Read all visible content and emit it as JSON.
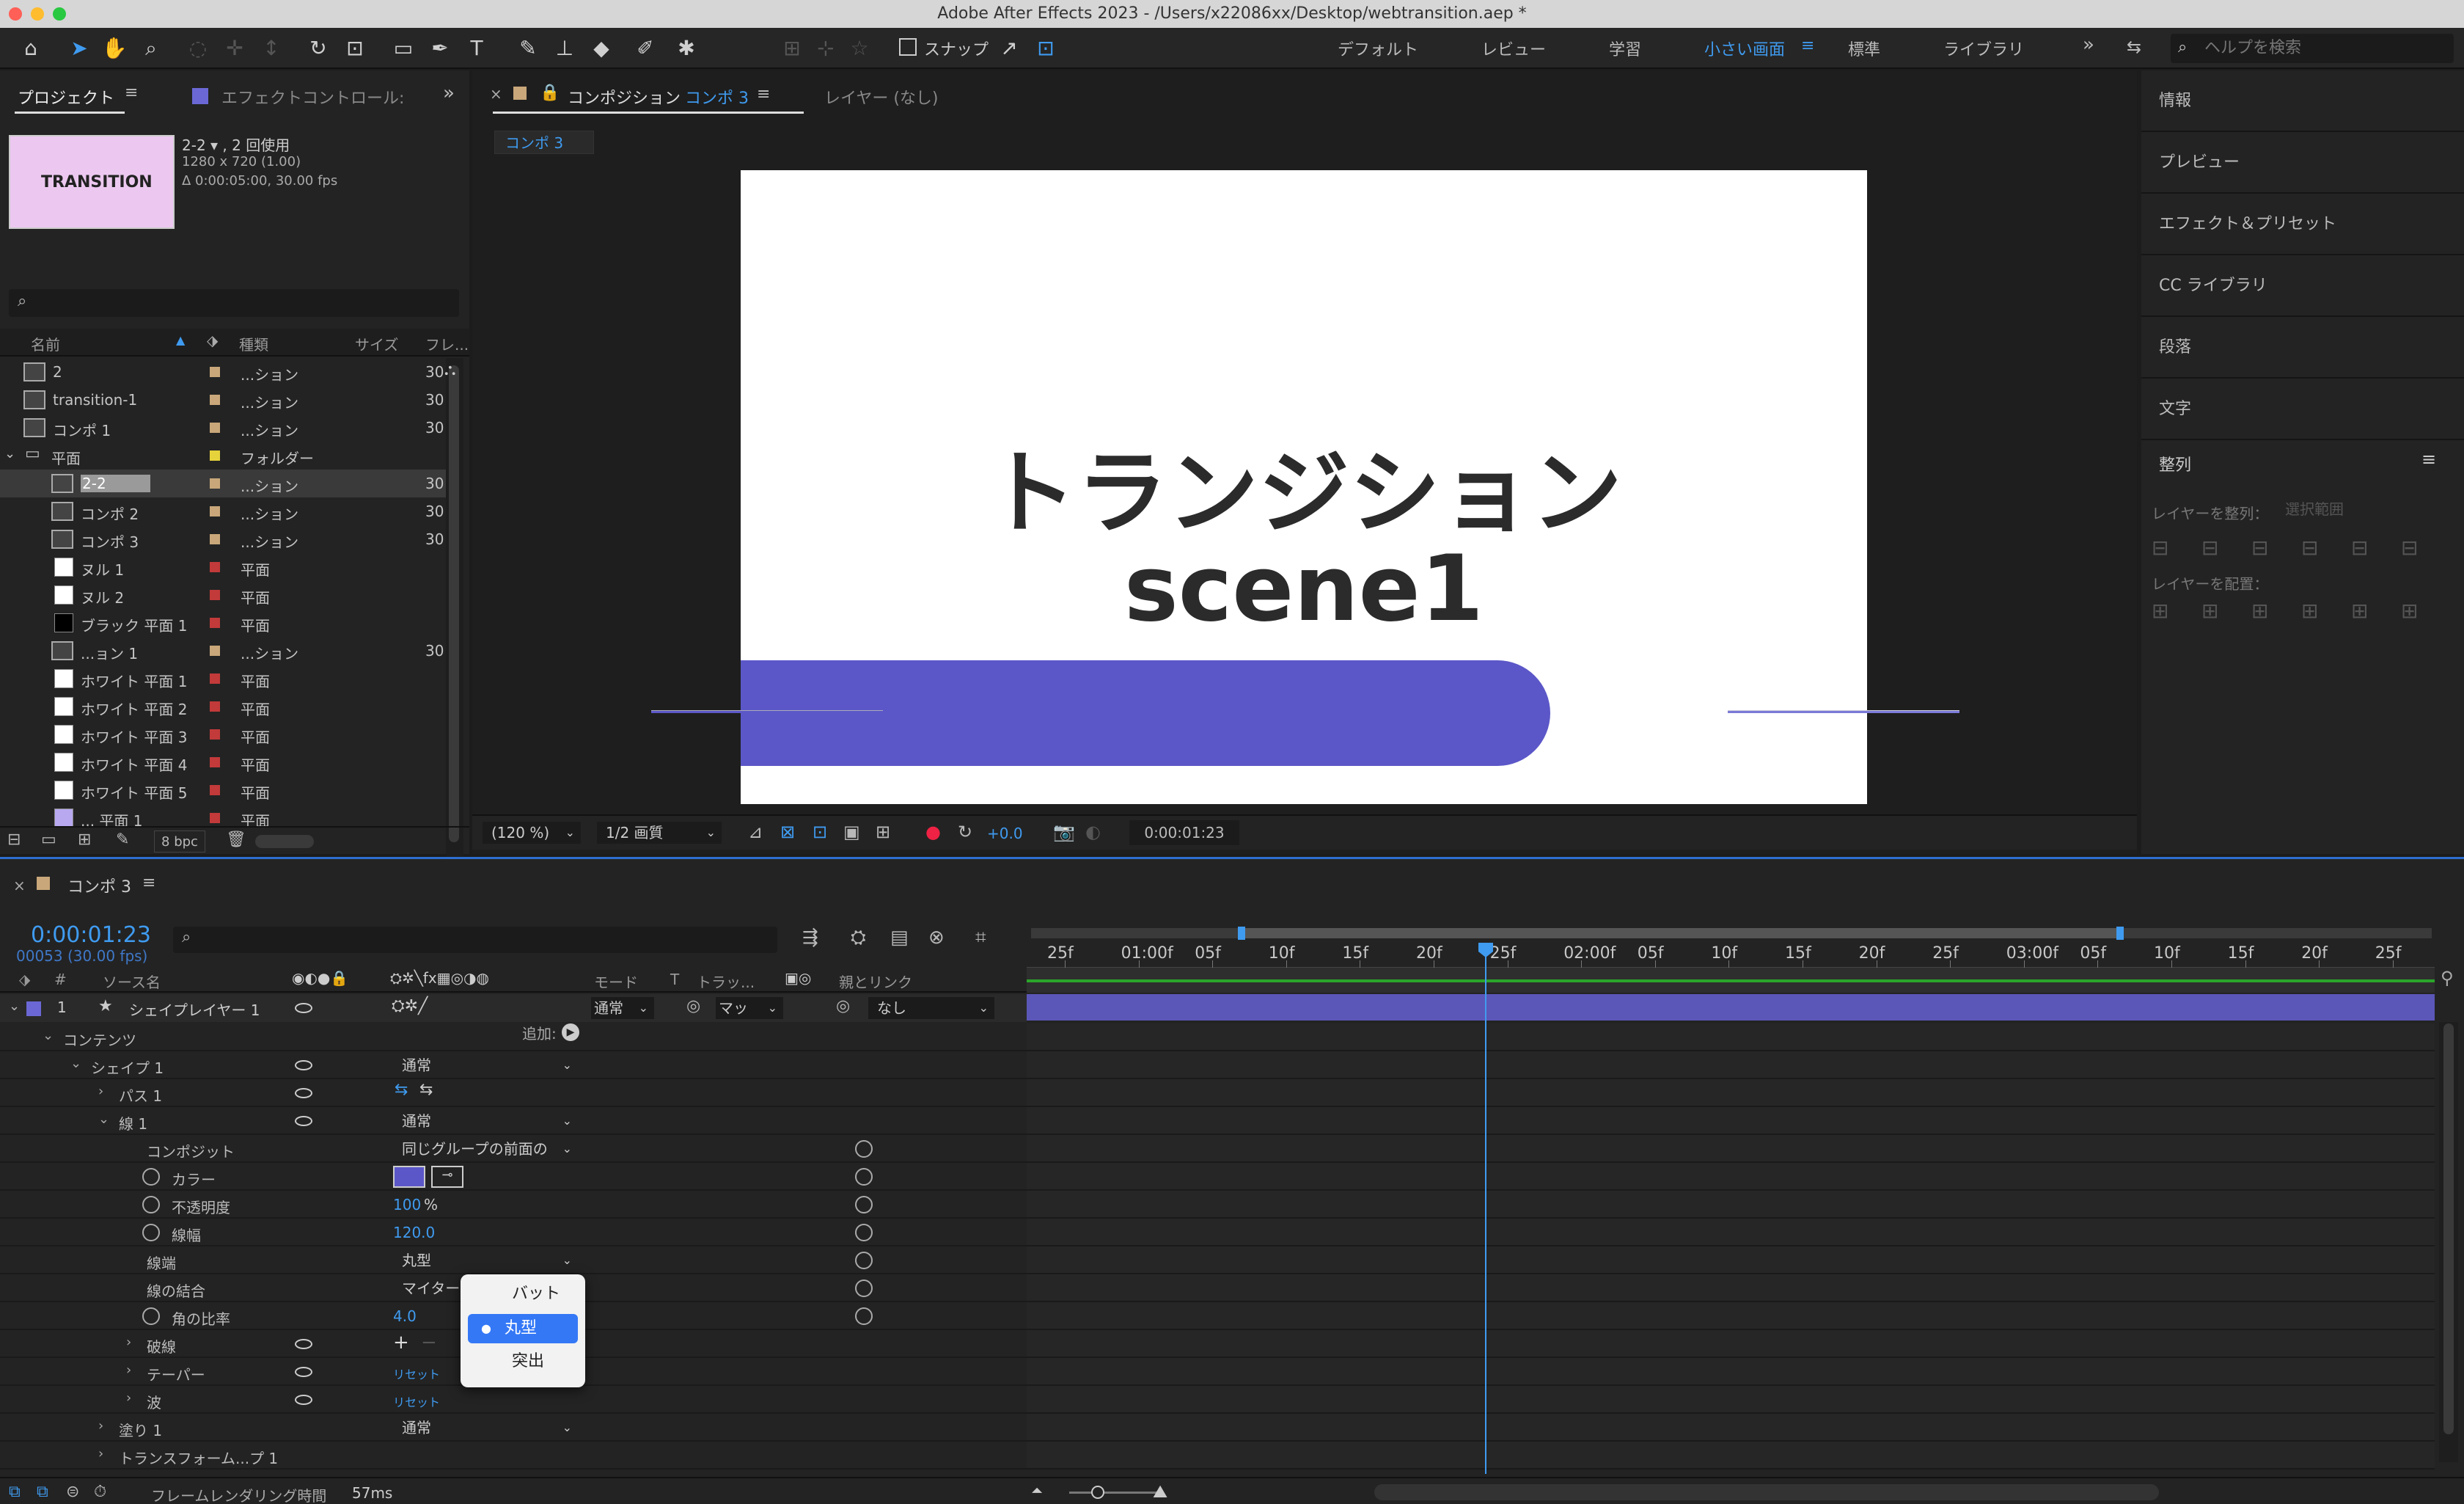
{
  "window": {
    "title": "Adobe After Effects 2023 - /Users/x22086xx/Desktop/webtransition.aep *"
  },
  "toolbar": {
    "snap_label": "スナップ",
    "workspaces": [
      "デフォルト",
      "レビュー",
      "学習",
      "小さい画面",
      "標準",
      "ライブラリ"
    ],
    "active_workspace": "小さい画面",
    "help_placeholder": "ヘルプを検索"
  },
  "project": {
    "tab_project": "プロジェクト",
    "tab_effects": "エフェクトコントロール:",
    "preview_label": "TRANSITION",
    "item_name": "2-2 ▾ , 2 回使用",
    "item_size": "1280 x 720 (1.00)",
    "item_duration": "Δ 0:00:05:00, 30.00 fps",
    "search_placeholder": "",
    "columns": [
      "名前",
      "種類",
      "サイズ",
      "フレ..."
    ],
    "bpc": "8 bpc",
    "items": [
      {
        "name": "2",
        "type": "...ション",
        "fps": "30",
        "color": "#c9a77a",
        "icon": "comp",
        "indent": 0
      },
      {
        "name": "transition-1",
        "type": "...ション",
        "fps": "30",
        "color": "#c9a77a",
        "icon": "comp",
        "indent": 0
      },
      {
        "name": "コンポ 1",
        "type": "...ション",
        "fps": "30",
        "color": "#c9a77a",
        "icon": "comp",
        "indent": 0
      },
      {
        "name": "平面",
        "type": "フォルダー",
        "fps": "",
        "color": "#e6d33b",
        "icon": "folder",
        "indent": 0
      },
      {
        "name": "2-2",
        "type": "...ション",
        "fps": "30",
        "color": "#c9a77a",
        "icon": "comp",
        "indent": 1,
        "selected": true
      },
      {
        "name": "コンポ 2",
        "type": "...ション",
        "fps": "30",
        "color": "#c9a77a",
        "icon": "comp",
        "indent": 1
      },
      {
        "name": "コンポ 3",
        "type": "...ション",
        "fps": "30",
        "color": "#c9a77a",
        "icon": "comp",
        "indent": 1
      },
      {
        "name": "ヌル 1",
        "type": "平面",
        "fps": "",
        "color": "#c23a3a",
        "icon": "white",
        "indent": 1
      },
      {
        "name": "ヌル 2",
        "type": "平面",
        "fps": "",
        "color": "#c23a3a",
        "icon": "white",
        "indent": 1
      },
      {
        "name": "ブラック 平面 1",
        "type": "平面",
        "fps": "",
        "color": "#c23a3a",
        "icon": "black",
        "indent": 1
      },
      {
        "name": "...ョン 1",
        "type": "...ション",
        "fps": "30",
        "color": "#c9a77a",
        "icon": "comp",
        "indent": 1
      },
      {
        "name": "ホワイト 平面 1",
        "type": "平面",
        "fps": "",
        "color": "#c23a3a",
        "icon": "white",
        "indent": 1
      },
      {
        "name": "ホワイト 平面 2",
        "type": "平面",
        "fps": "",
        "color": "#c23a3a",
        "icon": "white",
        "indent": 1
      },
      {
        "name": "ホワイト 平面 3",
        "type": "平面",
        "fps": "",
        "color": "#c23a3a",
        "icon": "white",
        "indent": 1
      },
      {
        "name": "ホワイト 平面 4",
        "type": "平面",
        "fps": "",
        "color": "#c23a3a",
        "icon": "white",
        "indent": 1
      },
      {
        "name": "ホワイト 平面 5",
        "type": "平面",
        "fps": "",
        "color": "#c23a3a",
        "icon": "white",
        "indent": 1
      },
      {
        "name": "... 平面 1",
        "type": "平面",
        "fps": "",
        "color": "#c23a3a",
        "icon": "lavender",
        "indent": 1
      }
    ]
  },
  "composition": {
    "tab_label": "コンポジション",
    "tab_comp": "コンポ 3",
    "layer_tab": "レイヤー (なし)",
    "comp_chip": "コンポ 3",
    "text_line1": "トランジション",
    "text_line2": "scene1",
    "bar_color": "#5b57c8",
    "zoom": "(120 %)",
    "quality": "1/2 画質",
    "exposure": "+0.0",
    "timecode": "0:00:01:23"
  },
  "right_panel": {
    "items": [
      "情報",
      "プレビュー",
      "エフェクト＆プリセット",
      "CC ライブラリ",
      "段落",
      "文字"
    ],
    "align_title": "整列",
    "align_to_label": "レイヤーを整列：",
    "align_to_value": "選択範囲",
    "distribute_label": "レイヤーを配置："
  },
  "timeline": {
    "tab": "コンポ 3",
    "timecode": "0:00:01:23",
    "frames": "00053 (30.00 fps)",
    "search_placeholder": "",
    "col_num": "#",
    "col_source": "ソース名",
    "col_mode": "モード",
    "col_t": "T",
    "col_track": "トラッ...",
    "col_parent": "親とリンク",
    "ruler": [
      "25f",
      "01:00f",
      "05f",
      "10f",
      "15f",
      "20f",
      "25f",
      "02:00f",
      "05f",
      "10f",
      "15f",
      "20f",
      "25f",
      "03:00f",
      "05f",
      "10f",
      "15f",
      "20f",
      "25f"
    ],
    "layer": {
      "num": "1",
      "name": "シェイプレイヤー 1",
      "mode": "通常",
      "track": "マッ",
      "parent": "なし",
      "color": "#6b68d6"
    },
    "add_label": "追加:",
    "rows": [
      {
        "label": "コンテンツ",
        "indent": 1,
        "arrow": "v"
      },
      {
        "label": "シェイプ 1",
        "indent": 2,
        "arrow": "v",
        "eye": true,
        "value": "通常",
        "kind": "select"
      },
      {
        "label": "パス 1",
        "indent": 3,
        "arrow": ">",
        "eye": true,
        "kind": "path"
      },
      {
        "label": "線 1",
        "indent": 3,
        "arrow": "v",
        "eye": true,
        "value": "通常",
        "kind": "select"
      },
      {
        "label": "コンポジット",
        "indent": 4,
        "value": "同じグループの前面の",
        "kind": "select",
        "spiral": true
      },
      {
        "label": "カラー",
        "indent": 4,
        "stopwatch": true,
        "kind": "color",
        "spiral": true
      },
      {
        "label": "不透明度",
        "indent": 4,
        "stopwatch": true,
        "value": "100",
        "unit": "%",
        "kind": "num",
        "spiral": true
      },
      {
        "label": "線幅",
        "indent": 4,
        "stopwatch": true,
        "value": "120.0",
        "kind": "num",
        "spiral": true
      },
      {
        "label": "線端",
        "indent": 4,
        "value": "丸型",
        "kind": "select",
        "spiral": true
      },
      {
        "label": "線の結合",
        "indent": 4,
        "value": "マイター",
        "kind": "select",
        "spiral": true
      },
      {
        "label": "角の比率",
        "indent": 4,
        "stopwatch": true,
        "value": "4.0",
        "kind": "num",
        "spiral": true
      },
      {
        "label": "破線",
        "indent": 4,
        "arrow": ">",
        "eye": true,
        "kind": "plus"
      },
      {
        "label": "テーパー",
        "indent": 4,
        "arrow": ">",
        "eye": true,
        "value": "リセット",
        "kind": "reset"
      },
      {
        "label": "波",
        "indent": 4,
        "arrow": ">",
        "eye": true,
        "value": "リセット",
        "kind": "reset"
      },
      {
        "label": "塗り 1",
        "indent": 3,
        "arrow": ">",
        "value": "通常",
        "kind": "select"
      },
      {
        "label": "トランスフォーム...プ 1",
        "indent": 3,
        "arrow": ">"
      }
    ],
    "dropdown": {
      "options": [
        "バット",
        "丸型",
        "突出"
      ],
      "selected": "丸型"
    },
    "render_label": "フレームレンダリング時間",
    "render_value": "57ms"
  }
}
